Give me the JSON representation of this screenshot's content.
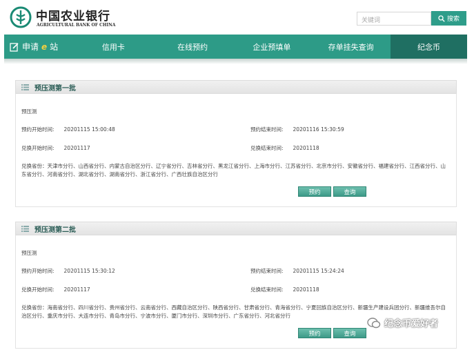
{
  "header": {
    "brand_cn": "中国农业银行",
    "brand_en": "AGRICULTURAL BANK OF CHINA",
    "search_placeholder": "关键词",
    "search_button": "搜索"
  },
  "nav": {
    "items": [
      {
        "label": "申请",
        "suffix": "站",
        "glyph": "e"
      },
      {
        "label": "信用卡"
      },
      {
        "label": "在线预约"
      },
      {
        "label": "企业预填单"
      },
      {
        "label": "存单挂失查询"
      },
      {
        "label": "纪念币"
      }
    ],
    "active_index": 5
  },
  "batches": [
    {
      "title": "预压测第一批",
      "name": "预压测",
      "reserve_start_label": "预约开始时间:",
      "reserve_start": "20201115 15:00:48",
      "reserve_end_label": "预约结束时间:",
      "reserve_end": "20201116 15:30:59",
      "exchange_start_label": "兑换开始时间:",
      "exchange_start": "20201117",
      "exchange_end_label": "兑换结束时间:",
      "exchange_end": "20201118",
      "provinces": "兑换省份：天津市分行、山西省分行、内蒙古自治区分行、辽宁省分行、吉林省分行、黑龙江省分行、上海市分行、江苏省分行、北京市分行、安徽省分行、福建省分行、江西省分行、山东省分行、河南省分行、湖北省分行、湖南省分行、浙江省分行、广西壮族自治区分行",
      "reserve_button": "预约",
      "query_button": "查询"
    },
    {
      "title": "预压测第二批",
      "name": "预压测",
      "reserve_start_label": "预约开始时间:",
      "reserve_start": "20201115 15:30:12",
      "reserve_end_label": "预约结束时间:",
      "reserve_end": "20201115 15:24:24",
      "exchange_start_label": "兑换开始时间:",
      "exchange_start": "20201117",
      "exchange_end_label": "兑换结束时间:",
      "exchange_end": "20201118",
      "provinces": "兑换省份：海南省分行、四川省分行、贵州省分行、云南省分行、西藏自治区分行、陕西省分行、甘肃省分行、青海省分行、宁夏回族自治区分行、新疆生产建设兵团分行、新疆维吾尔自治区分行、重庆市分行、大连市分行、青岛市分行、宁波市分行、厦门市分行、深圳市分行、广东省分行、河北省分行",
      "reserve_button": "预约",
      "query_button": "查询"
    }
  ],
  "watermark": "纪念币爱好者",
  "colors": {
    "accent": "#2d9b87",
    "accent_dark": "#1f6f62"
  },
  "icons": [
    "abc-logo-icon",
    "search-icon",
    "apply-station-icon",
    "list-icon",
    "wechat-icon"
  ]
}
